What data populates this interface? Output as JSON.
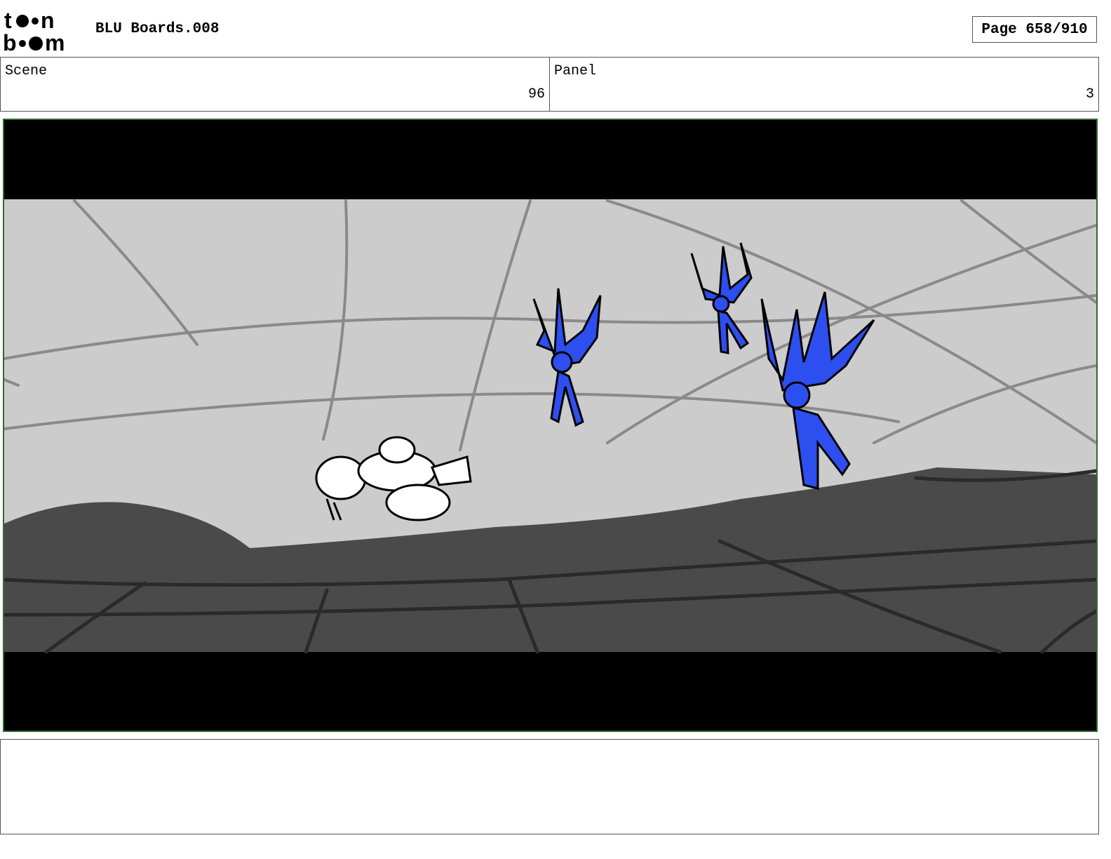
{
  "header": {
    "logo_text": "toon boom",
    "title": "BLU Boards.008",
    "page_label": "Page 658/910"
  },
  "scene": {
    "label": "Scene",
    "value": "96"
  },
  "panel": {
    "label": "Panel",
    "value": "3"
  },
  "drawing": {
    "description_icon": "storyboard-frame",
    "colors": {
      "sky": "#cccccc",
      "ground": "#4a4a4a",
      "letterbox": "#000000",
      "character_accent": "#2d4ff0",
      "frame_border": "#2f6b2f"
    }
  },
  "notes": {
    "text": ""
  }
}
